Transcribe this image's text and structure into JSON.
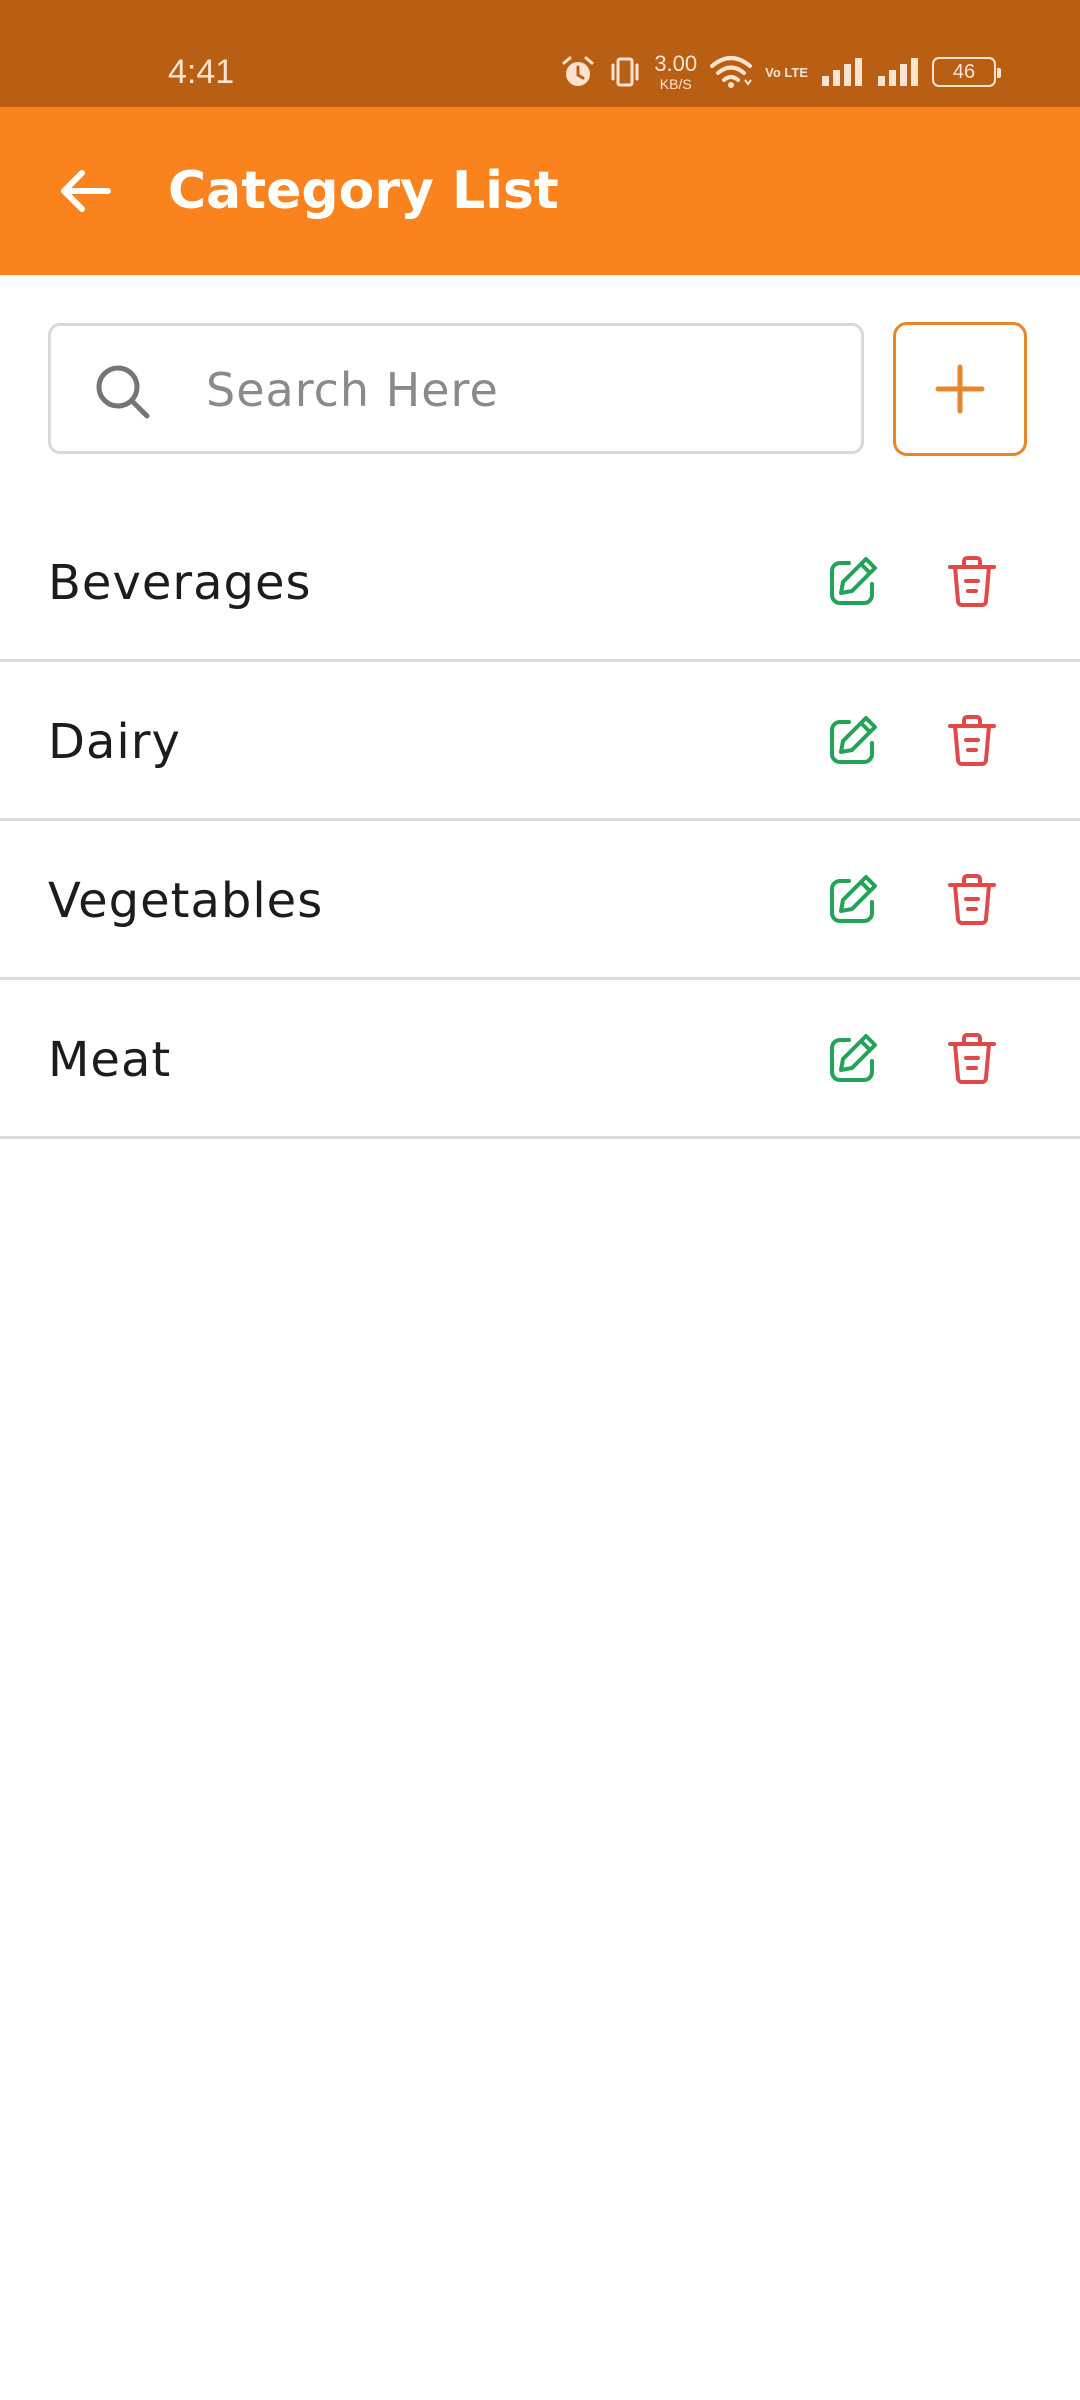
{
  "status_bar": {
    "time": "4:41",
    "net_speed_value": "3.00",
    "net_speed_unit": "KB/S",
    "volte": "Vo LTE",
    "battery": "46"
  },
  "app_bar": {
    "title": "Category List",
    "color": "#fb831d"
  },
  "search": {
    "placeholder": "Search Here",
    "value": ""
  },
  "categories": [
    {
      "label": "Beverages"
    },
    {
      "label": "Dairy"
    },
    {
      "label": "Vegetables"
    },
    {
      "label": "Meat"
    }
  ],
  "colors": {
    "accent": "#e8862a",
    "edit": "#22a357",
    "delete": "#e14848"
  }
}
